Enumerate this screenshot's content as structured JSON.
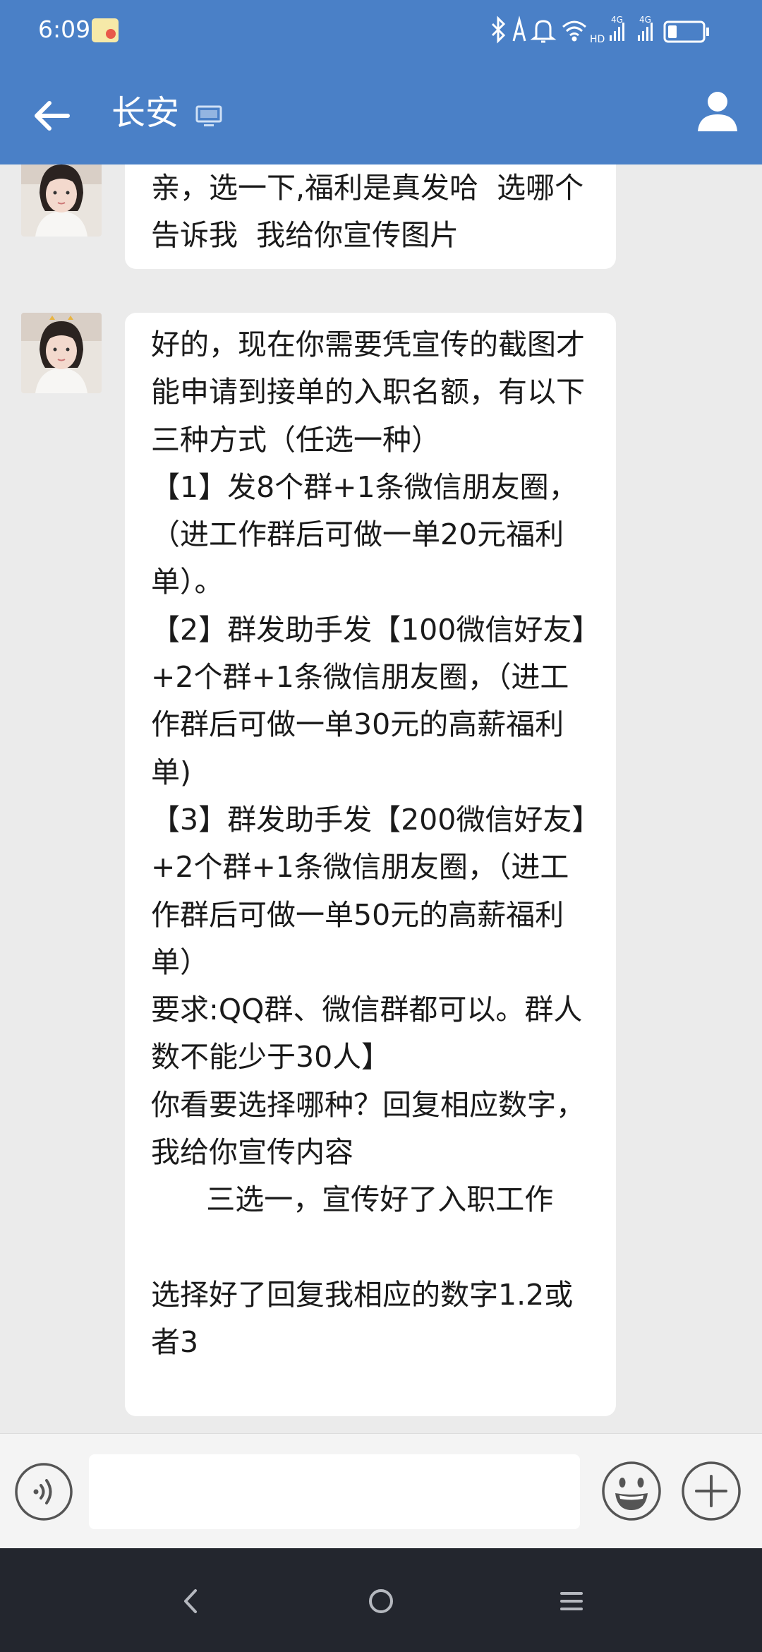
{
  "status_bar": {
    "time": "6:09",
    "network_label_1": "4G",
    "network_label_2": "4G",
    "hd_label": "HD"
  },
  "header": {
    "title": "长安",
    "background": "#4a80c7"
  },
  "messages": [
    {
      "sender": "contact",
      "text": "亲，选一下,福利是真发哈  选哪个告诉我  我给你宣传图片"
    },
    {
      "sender": "contact",
      "text": "好的，现在你需要凭宣传的截图才能申请到接单的入职名额，有以下三种方式（任选一种）\n【1】发8个群+1条微信朋友圈，（进工作群后可做一单20元福利单）。\n【2】群发助手发【100微信好友】+2个群+1条微信朋友圈，（进工作群后可做一单30元的高薪福利单)\n【3】群发助手发【200微信好友】+2个群+1条微信朋友圈，（进工作群后可做一单50元的高薪福利单）\n要求:QQ群、微信群都可以。群人数不能少于30人】\n你看要选择哪种？回复相应数字，我给你宣传内容\n      三选一，宣传好了入职工作\n\n选择好了回复我相应的数字1.2或者3"
    }
  ],
  "input_bar": {
    "placeholder": ""
  },
  "icons": {
    "back": "arrow-left-icon",
    "profile": "person-icon",
    "device": "computer-icon",
    "voice": "voice-icon",
    "emoji": "smiley-icon",
    "more": "plus-icon"
  }
}
